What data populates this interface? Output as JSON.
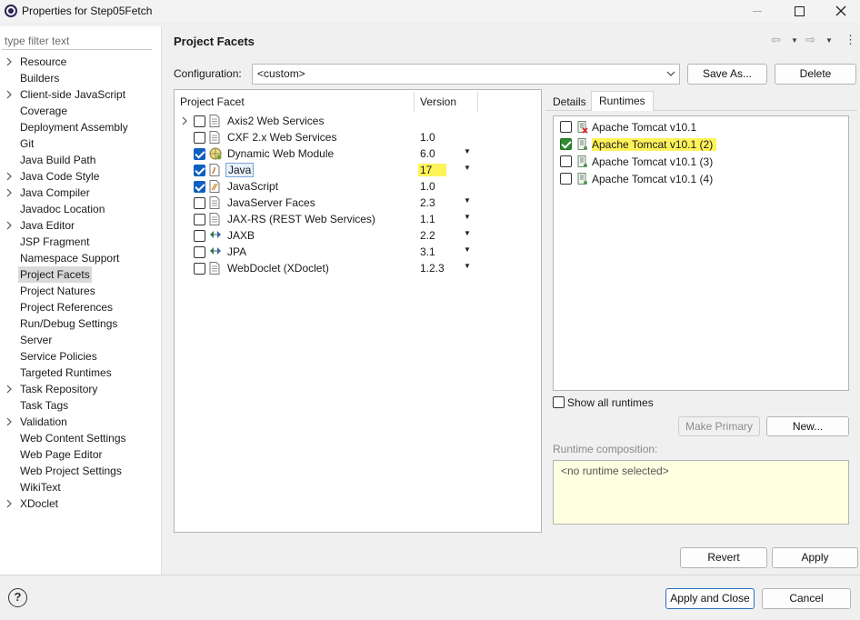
{
  "window": {
    "title": "Properties for Step05Fetch"
  },
  "filter": {
    "placeholder": "type filter text"
  },
  "nav": [
    {
      "label": "Resource",
      "expandable": true
    },
    {
      "label": "Builders",
      "expandable": false
    },
    {
      "label": "Client-side JavaScript",
      "expandable": true
    },
    {
      "label": "Coverage",
      "expandable": false
    },
    {
      "label": "Deployment Assembly",
      "expandable": false
    },
    {
      "label": "Git",
      "expandable": false
    },
    {
      "label": "Java Build Path",
      "expandable": false
    },
    {
      "label": "Java Code Style",
      "expandable": true
    },
    {
      "label": "Java Compiler",
      "expandable": true
    },
    {
      "label": "Javadoc Location",
      "expandable": false
    },
    {
      "label": "Java Editor",
      "expandable": true
    },
    {
      "label": "JSP Fragment",
      "expandable": false
    },
    {
      "label": "Namespace Support",
      "expandable": false
    },
    {
      "label": "Project Facets",
      "expandable": false,
      "selected": true
    },
    {
      "label": "Project Natures",
      "expandable": false
    },
    {
      "label": "Project References",
      "expandable": false
    },
    {
      "label": "Run/Debug Settings",
      "expandable": false
    },
    {
      "label": "Server",
      "expandable": false
    },
    {
      "label": "Service Policies",
      "expandable": false
    },
    {
      "label": "Targeted Runtimes",
      "expandable": false
    },
    {
      "label": "Task Repository",
      "expandable": true
    },
    {
      "label": "Task Tags",
      "expandable": false
    },
    {
      "label": "Validation",
      "expandable": true
    },
    {
      "label": "Web Content Settings",
      "expandable": false
    },
    {
      "label": "Web Page Editor",
      "expandable": false
    },
    {
      "label": "Web Project Settings",
      "expandable": false
    },
    {
      "label": "WikiText",
      "expandable": false
    },
    {
      "label": "XDoclet",
      "expandable": true
    }
  ],
  "main": {
    "title": "Project Facets",
    "config_label": "Configuration:",
    "config_value": "<custom>",
    "save_as": "Save As...",
    "delete": "Delete"
  },
  "facets": {
    "col_facet": "Project Facet",
    "col_version": "Version",
    "rows": [
      {
        "name": "Axis2 Web Services",
        "version": "",
        "checked": false,
        "expandable": true,
        "dropdown": false,
        "icon": "page-icon"
      },
      {
        "name": "CXF 2.x Web Services",
        "version": "1.0",
        "checked": false,
        "dropdown": false,
        "icon": "page-icon"
      },
      {
        "name": "Dynamic Web Module",
        "version": "6.0",
        "checked": true,
        "dropdown": true,
        "icon": "web-module-icon"
      },
      {
        "name": "Java",
        "version": "17",
        "checked": true,
        "dropdown": true,
        "icon": "java-icon",
        "selected": true,
        "highlight": true
      },
      {
        "name": "JavaScript",
        "version": "1.0",
        "checked": true,
        "dropdown": false,
        "icon": "javascript-icon"
      },
      {
        "name": "JavaServer Faces",
        "version": "2.3",
        "checked": false,
        "dropdown": true,
        "icon": "page-icon"
      },
      {
        "name": "JAX-RS (REST Web Services)",
        "version": "1.1",
        "checked": false,
        "dropdown": true,
        "icon": "page-icon"
      },
      {
        "name": "JAXB",
        "version": "2.2",
        "checked": false,
        "dropdown": true,
        "icon": "binding-icon"
      },
      {
        "name": "JPA",
        "version": "3.1",
        "checked": false,
        "dropdown": true,
        "icon": "binding-icon"
      },
      {
        "name": "WebDoclet (XDoclet)",
        "version": "1.2.3",
        "checked": false,
        "dropdown": true,
        "icon": "page-icon"
      }
    ]
  },
  "tabs": {
    "details": "Details",
    "runtimes": "Runtimes"
  },
  "runtimes": [
    {
      "name": "Apache Tomcat v10.1",
      "checked": false,
      "error": true
    },
    {
      "name": "Apache Tomcat v10.1 (2)",
      "checked": true,
      "highlight": true
    },
    {
      "name": "Apache Tomcat v10.1 (3)",
      "checked": false
    },
    {
      "name": "Apache Tomcat v10.1 (4)",
      "checked": false
    }
  ],
  "show_all": "Show all runtimes",
  "make_primary": "Make Primary",
  "new_btn": "New...",
  "composition_label": "Runtime composition:",
  "composition_value": "<no runtime selected>",
  "revert": "Revert",
  "apply": "Apply",
  "apply_close": "Apply and Close",
  "cancel": "Cancel",
  "colors": {
    "highlight": "#fff35a",
    "check_blue": "#0f5fc2",
    "check_green": "#2f8a2f"
  }
}
